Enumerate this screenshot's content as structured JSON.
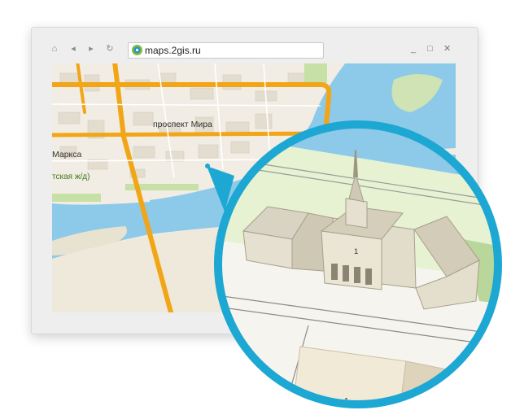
{
  "browser": {
    "url": "maps.2gis.ru",
    "nav_icons": [
      "home-icon",
      "back-arrow-icon",
      "forward-arrow-icon",
      "refresh-icon"
    ],
    "window_controls": {
      "minimize": "_",
      "maximize": "□",
      "close": "✕"
    }
  },
  "map": {
    "labels": {
      "avenue": "проспект Мира",
      "street_left": "Маркса",
      "station": "тская ж/д)"
    }
  },
  "zoom": {
    "building_number": "1",
    "building_number_lower": "1"
  },
  "colors": {
    "water": "#8dc9e8",
    "road": "#f2a516",
    "park": "#dcebc7",
    "ring": "#1da7d3"
  }
}
